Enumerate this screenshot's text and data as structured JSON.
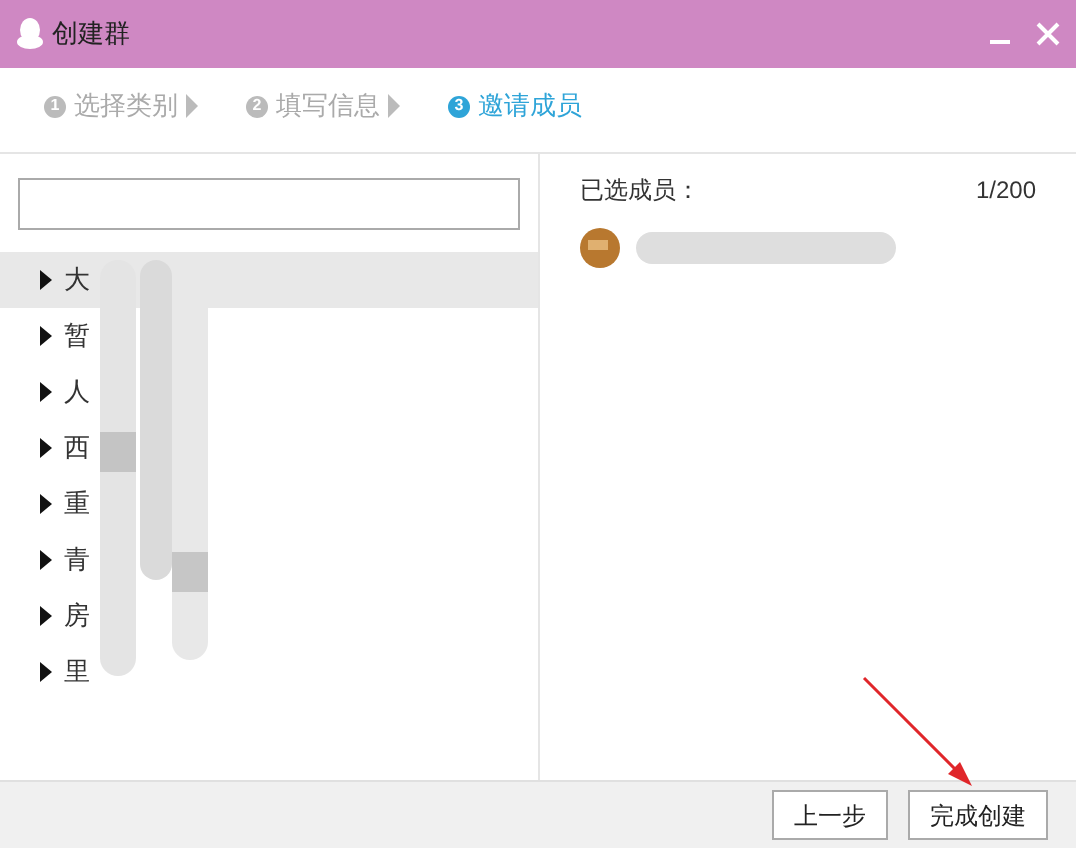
{
  "window": {
    "title": "创建群"
  },
  "steps": [
    {
      "number": "1",
      "label": "选择类别",
      "selected": false
    },
    {
      "number": "2",
      "label": "填写信息",
      "selected": false
    },
    {
      "number": "3",
      "label": "邀请成员",
      "selected": true
    }
  ],
  "groups": [
    {
      "label": "大",
      "selected": true
    },
    {
      "label": "暂",
      "selected": false
    },
    {
      "label": "人",
      "selected": false
    },
    {
      "label": "西",
      "selected": false
    },
    {
      "label": "重",
      "selected": false
    },
    {
      "label": "青",
      "selected": false
    },
    {
      "label": "房",
      "selected": false
    },
    {
      "label": "里",
      "selected": false
    }
  ],
  "selected_members": {
    "label": "已选成员：",
    "count": "1/200"
  },
  "buttons": [
    {
      "label": "上一步"
    },
    {
      "label": "完成创建"
    }
  ]
}
